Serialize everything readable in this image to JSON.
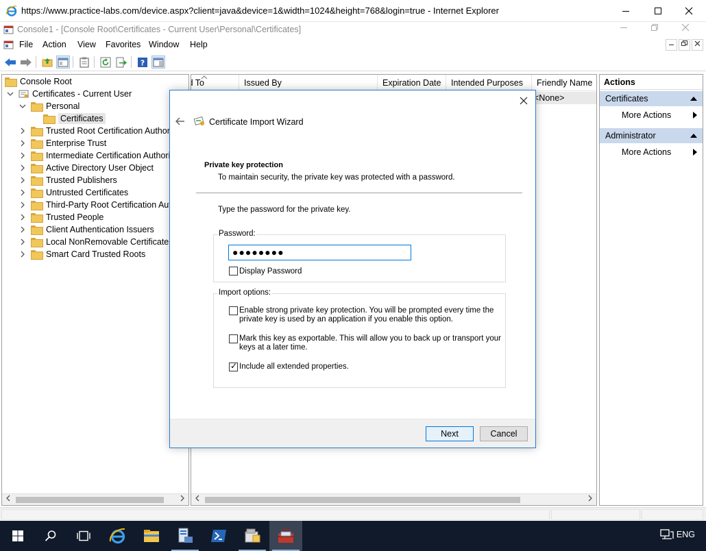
{
  "browser": {
    "title": "https://www.practice-labs.com/device.aspx?client=java&device=1&width=1024&height=768&login=true - Internet Explorer"
  },
  "console": {
    "title": "Console1 - [Console Root\\Certificates - Current User\\Personal\\Certificates]",
    "menu": [
      "File",
      "Action",
      "View",
      "Favorites",
      "Window",
      "Help"
    ]
  },
  "tree": {
    "root": "Console Root",
    "store": "Certificates - Current User",
    "personal": "Personal",
    "certificates": "Certificates",
    "folders": [
      "Trusted Root Certification Authorities",
      "Enterprise Trust",
      "Intermediate Certification Authorities",
      "Active Directory User Object",
      "Trusted Publishers",
      "Untrusted Certificates",
      "Third-Party Root Certification Authorities",
      "Trusted People",
      "Client Authentication Issuers",
      "Local NonRemovable Certificates",
      "Smart Card Trusted Roots"
    ]
  },
  "list": {
    "columns": [
      "Issued To",
      "Issued By",
      "Expiration Date",
      "Intended Purposes",
      "Friendly Name"
    ],
    "row_friendly_name": "<None>"
  },
  "actions": {
    "title": "Actions",
    "section1": "Certificates",
    "section1_item": "More Actions",
    "section2": "Administrator",
    "section2_item": "More Actions"
  },
  "wizard": {
    "title": "Certificate Import Wizard",
    "heading": "Private key protection",
    "subheading": "To maintain security, the private key was protected with a password.",
    "instruction": "Type the password for the private key.",
    "password_group": "Password:",
    "password_value": "●●●●●●●●",
    "display_password": "Display Password",
    "display_password_checked": false,
    "import_group": "Import options:",
    "options": [
      {
        "line1": "Enable strong private key protection. You will be prompted every time the",
        "line2": "private key is used by an application if you enable this option.",
        "checked": false
      },
      {
        "line1": "Mark this key as exportable. This will allow you to back up or transport your",
        "line2": "keys at a later time.",
        "checked": false
      },
      {
        "line1": "Include all extended properties.",
        "line2": "",
        "checked": true
      }
    ],
    "next": "Next",
    "cancel": "Cancel"
  },
  "taskbar": {
    "language": "ENG"
  },
  "colors": {
    "accent": "#0078d7",
    "actions_section": "#c9d8ec",
    "taskbar": "#101a2a"
  }
}
